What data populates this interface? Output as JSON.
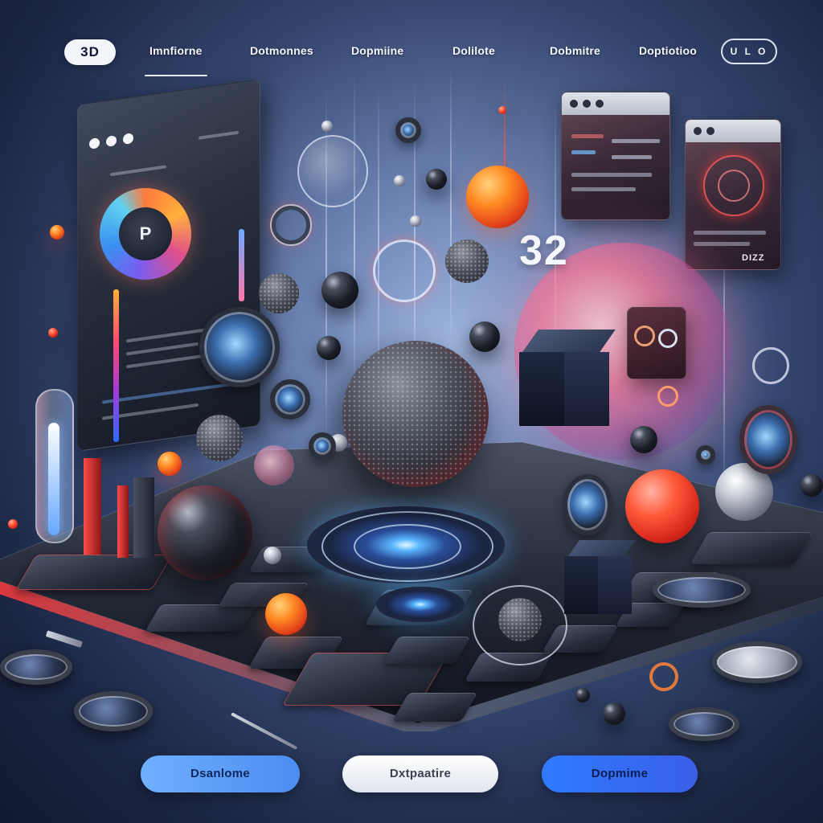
{
  "nav": {
    "logo": "3D",
    "links": [
      "Imnfiorne",
      "Dotmonnes",
      "Dopmiine",
      "Dolilote",
      "Dobmitre",
      "Doptiotioo"
    ],
    "toggle": "U L O"
  },
  "left_panel": {
    "ring_label": "P"
  },
  "right_windows": {
    "label": "DIZZ"
  },
  "hero": {
    "number": "32"
  },
  "buttons": {
    "primary": "Dsanlome",
    "secondary": "Dxtpaatire",
    "tertiary": "Dopmime"
  },
  "colors": {
    "accent_blue": "#4b8cf0",
    "accent_orange": "#ff8a24",
    "accent_red": "#d6261c",
    "glow_pink": "#ff7896"
  }
}
